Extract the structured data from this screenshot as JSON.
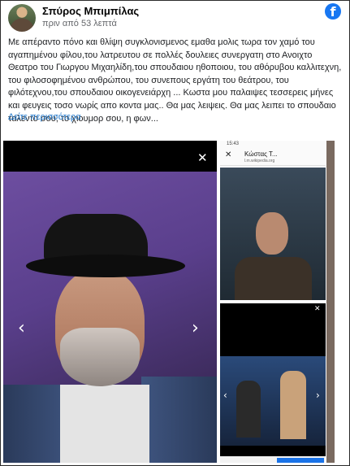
{
  "post": {
    "author": "Σπύρος Μπιμπίλας",
    "time": "πριν από 53 λεπτά",
    "text": "Με απέραντο πόνο και θλίψη συγκλονισμενος εμαθα μολις τωρα τον χαμό του αγαπημένου φίλου,του λατρευτου σε πολλές δουλειες συνεργατη στο Ανοιχτο Θεατρο του Γιωργου Μιχαηλίδη,του σπουδαιου ηθοποιου, του αθόρυβου καλλιτεχνη, του φιλοσοφημένου ανθρώπου, του συνεπους εργάτη του θεάτρου, του φιλότεχνου,του σπουδαιου οικογενειάρχη ... Κωστα μου παλαιψες τεσσερεις μήνες και φευγεις τοσο νωρίς απο κοντα μας.. Θα μας λειψεις. Θα μας λειπει το σπουδαιο ταλεντο σου, το χιουμορ σου, η φων...",
    "see_more": "Δείτε περισσότερα"
  },
  "icons": {
    "facebook": "f",
    "close": "✕",
    "prev": "‹",
    "next": "›"
  },
  "phone_shot": {
    "status_time": "15:43",
    "page_title": "Κώστας Τ...",
    "page_url": "l.m.wikipedia.org"
  },
  "colors": {
    "brand": "#1877f2",
    "link": "#1a73c8"
  }
}
